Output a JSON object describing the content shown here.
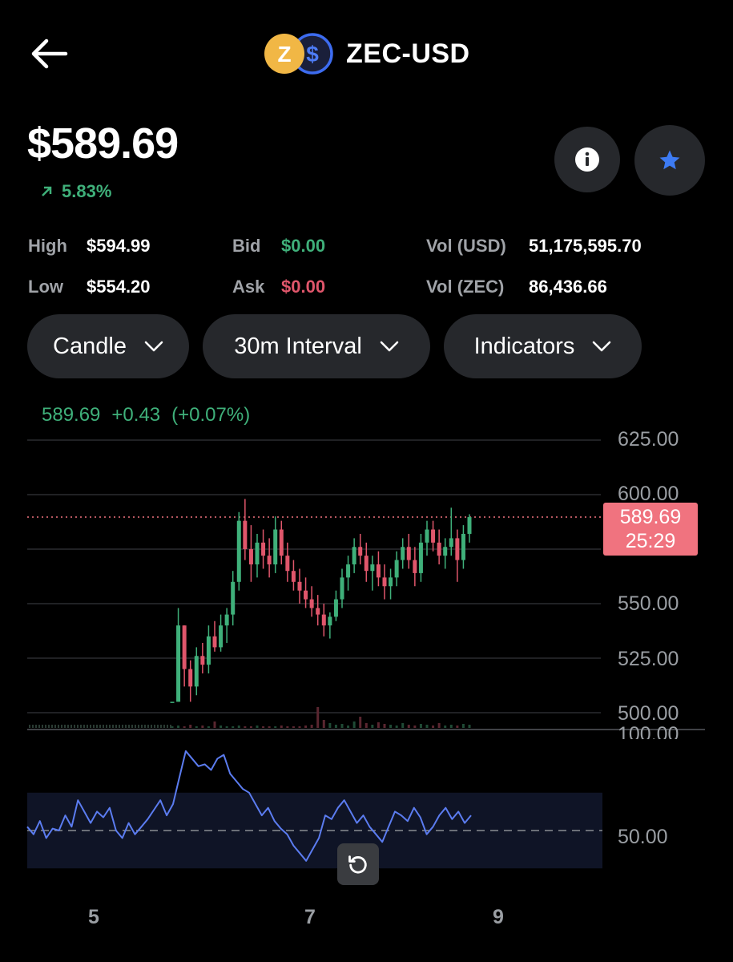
{
  "header": {
    "back_icon": "arrow-left-icon",
    "pair_title": "ZEC-USD",
    "base_icon": "zcash-coin-icon",
    "quote_icon": "usd-coin-icon",
    "base_symbol": "Z",
    "quote_symbol": "$"
  },
  "price": {
    "value": "$589.69",
    "change_pct": "5.83%",
    "change_icon": "arrow-up-right-icon"
  },
  "actions": {
    "info_icon": "info-icon",
    "watchlist_icon": "star-icon"
  },
  "stats": {
    "high_label": "High",
    "high_value": "$594.99",
    "low_label": "Low",
    "low_value": "$554.20",
    "bid_label": "Bid",
    "bid_value": "$0.00",
    "ask_label": "Ask",
    "ask_value": "$0.00",
    "vol_usd_label": "Vol (USD)",
    "vol_usd_value": "51,175,595.70",
    "vol_zec_label": "Vol (ZEC)",
    "vol_zec_value": "86,436.66"
  },
  "controls": {
    "chart_type": "Candle",
    "interval": "30m Interval",
    "indicators": "Indicators"
  },
  "ohlc_readout": {
    "last": "589.69",
    "change": "+0.43",
    "change_pct": "(+0.07%)"
  },
  "price_tag": {
    "price": "589.69",
    "countdown": "25:29"
  },
  "colors": {
    "up": "#3fb07a",
    "down": "#e0566b",
    "rsi": "#5b7cf0",
    "tag": "#f0737f",
    "star": "#3d7bf3"
  },
  "chart_data": {
    "type": "candlestick",
    "y_ticks": [
      "625.00",
      "600.00",
      "550.00",
      "525.00",
      "500.00"
    ],
    "ylim": [
      500,
      625
    ],
    "x_ticks": [
      "5",
      "7",
      "9"
    ],
    "last_price": 589.69,
    "candles": [
      [
        505,
        505,
        505,
        505
      ],
      [
        505,
        548,
        505,
        540
      ],
      [
        540,
        540,
        512,
        520
      ],
      [
        520,
        524,
        505,
        512
      ],
      [
        512,
        530,
        508,
        526
      ],
      [
        526,
        532,
        518,
        522
      ],
      [
        522,
        540,
        518,
        535
      ],
      [
        535,
        542,
        528,
        530
      ],
      [
        530,
        545,
        528,
        540
      ],
      [
        540,
        548,
        532,
        545
      ],
      [
        545,
        565,
        540,
        560
      ],
      [
        560,
        592,
        556,
        588
      ],
      [
        588,
        598,
        570,
        575
      ],
      [
        575,
        586,
        560,
        568
      ],
      [
        568,
        582,
        562,
        578
      ],
      [
        578,
        584,
        566,
        572
      ],
      [
        572,
        580,
        562,
        568
      ],
      [
        568,
        590,
        564,
        584
      ],
      [
        584,
        588,
        568,
        572
      ],
      [
        572,
        578,
        560,
        565
      ],
      [
        565,
        570,
        556,
        560
      ],
      [
        560,
        566,
        550,
        556
      ],
      [
        556,
        562,
        548,
        552
      ],
      [
        552,
        558,
        544,
        548
      ],
      [
        548,
        554,
        540,
        545
      ],
      [
        545,
        550,
        535,
        540
      ],
      [
        540,
        546,
        534,
        544
      ],
      [
        544,
        556,
        542,
        552
      ],
      [
        552,
        566,
        548,
        562
      ],
      [
        562,
        572,
        556,
        568
      ],
      [
        568,
        580,
        564,
        576
      ],
      [
        576,
        582,
        568,
        572
      ],
      [
        572,
        578,
        560,
        565
      ],
      [
        565,
        572,
        556,
        568
      ],
      [
        568,
        574,
        558,
        562
      ],
      [
        562,
        568,
        552,
        558
      ],
      [
        558,
        566,
        552,
        562
      ],
      [
        562,
        574,
        558,
        570
      ],
      [
        570,
        580,
        566,
        576
      ],
      [
        576,
        582,
        566,
        570
      ],
      [
        570,
        576,
        558,
        564
      ],
      [
        564,
        582,
        560,
        578
      ],
      [
        578,
        588,
        572,
        584
      ],
      [
        584,
        588,
        574,
        578
      ],
      [
        578,
        584,
        568,
        572
      ],
      [
        572,
        580,
        566,
        576
      ],
      [
        576,
        594,
        572,
        580
      ],
      [
        580,
        584,
        560,
        570
      ],
      [
        570,
        586,
        566,
        582
      ],
      [
        582,
        591,
        578,
        589.69
      ]
    ],
    "volumes": [
      2,
      3,
      2,
      4,
      2,
      3,
      2,
      8,
      3,
      2,
      2,
      3,
      2,
      2,
      3,
      2,
      2,
      2,
      3,
      2,
      2,
      2,
      3,
      4,
      26,
      10,
      6,
      4,
      5,
      3,
      8,
      14,
      6,
      4,
      7,
      5,
      4,
      3,
      6,
      4,
      3,
      5,
      4,
      3,
      6,
      3,
      4,
      3,
      5,
      4
    ],
    "rsi": {
      "name": "RSI",
      "ticks": [
        "100.00",
        "50.00"
      ],
      "ylim": [
        25,
        100
      ],
      "band": [
        30,
        70
      ],
      "values": [
        52,
        48,
        55,
        46,
        51,
        50,
        58,
        52,
        66,
        60,
        54,
        60,
        57,
        62,
        50,
        46,
        54,
        48,
        52,
        56,
        61,
        66,
        58,
        64,
        78,
        92,
        88,
        84,
        85,
        82,
        88,
        90,
        80,
        76,
        72,
        70,
        64,
        58,
        62,
        55,
        51,
        48,
        42,
        38,
        34,
        40,
        46,
        58,
        56,
        62,
        66,
        60,
        54,
        58,
        52,
        48,
        44,
        52,
        60,
        58,
        55,
        62,
        57,
        48,
        52,
        58,
        62,
        56,
        60,
        54,
        58
      ]
    }
  }
}
